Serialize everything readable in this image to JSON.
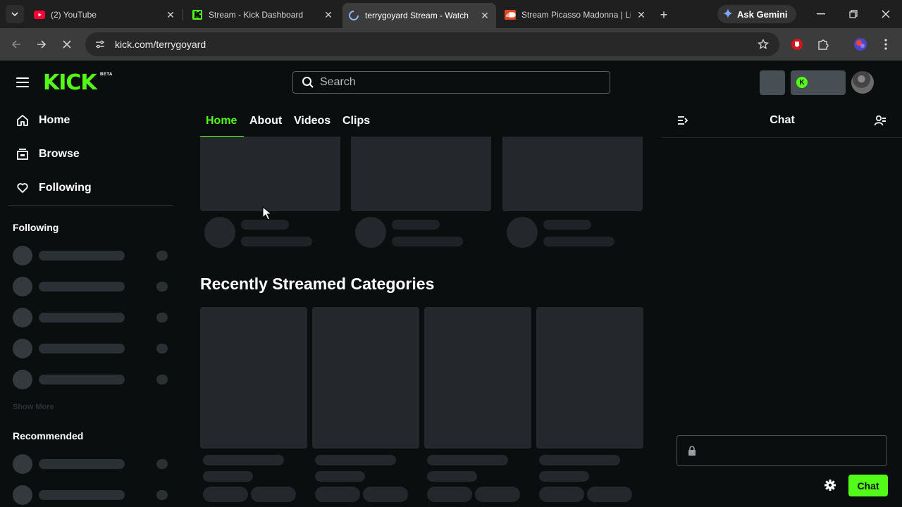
{
  "browser": {
    "tabs": [
      {
        "title": "(2) YouTube",
        "icon": "youtube-icon",
        "active": false
      },
      {
        "title": "Stream - Kick Dashboard",
        "icon": "kick-icon",
        "active": false
      },
      {
        "title": "terrygoyard Stream - Watch",
        "icon": "loading-spinner-icon",
        "active": true
      },
      {
        "title": "Stream Picasso Madonna | Li",
        "icon": "soundcloud-icon",
        "active": false
      }
    ],
    "gemini_label": "Ask Gemini",
    "url": "kick.com/terrygoyard"
  },
  "kick": {
    "logo_text": "KICK",
    "logo_badge": "BETA",
    "search_placeholder": "Search",
    "sidebar": {
      "nav": [
        {
          "label": "Home",
          "icon": "home-icon"
        },
        {
          "label": "Browse",
          "icon": "browse-icon"
        },
        {
          "label": "Following",
          "icon": "heart-icon"
        }
      ],
      "following_heading": "Following",
      "show_more": "Show More",
      "recommended_heading": "Recommended"
    },
    "channel_tabs": [
      "Home",
      "About",
      "Videos",
      "Clips"
    ],
    "section_title": "Recently Streamed Categories",
    "chat": {
      "title": "Chat",
      "send_label": "Chat"
    },
    "colors": {
      "brand": "#53fc18",
      "background": "#0b0e0f",
      "skeleton": "#24272c"
    }
  }
}
